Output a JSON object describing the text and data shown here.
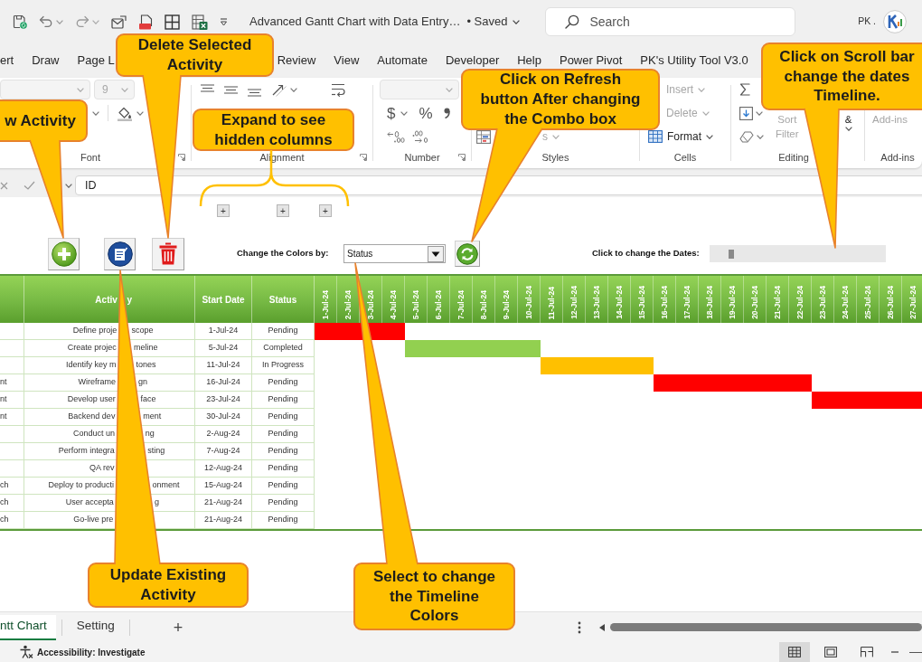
{
  "title_bar": {
    "title": "Advanced Gantt Chart with Data Entry…",
    "status": "• Saved",
    "search": {
      "placeholder": "Search"
    },
    "user": "PK ."
  },
  "tabs": [
    {
      "label": "ert"
    },
    {
      "label": "Draw"
    },
    {
      "label": "Page L"
    },
    {
      "label": "Review"
    },
    {
      "label": "View"
    },
    {
      "label": "Automate"
    },
    {
      "label": "Developer"
    },
    {
      "label": "Help"
    },
    {
      "label": "Power Pivot"
    },
    {
      "label": "PK's Utility Tool V3.0"
    }
  ],
  "ribbon": {
    "font": {
      "size": {
        "value": "9",
        "disabled": true
      },
      "label": "Font"
    },
    "alignment": {
      "label": "Alignment"
    },
    "number": {
      "currency": "$",
      "percent": "%",
      "label": "Number"
    },
    "styles": {
      "cell_styles": {
        "label": "s",
        "disabled": true
      },
      "label": "Styles"
    },
    "cells": {
      "buttons": [
        {
          "label": "Insert",
          "disabled": true
        },
        {
          "label": "Delete",
          "disabled": true
        },
        {
          "label": "Format",
          "disabled": false
        }
      ],
      "label": "Cells"
    },
    "editing": {
      "sort_filter": {
        "lines": [
          "Sort",
          "Filter"
        ],
        "disabled": true
      },
      "find_select": {
        "label": "&",
        "disabled": false
      },
      "label": "Editing"
    },
    "add_ins": {
      "button": {
        "label": "Add-ins",
        "disabled": true
      },
      "label": "Add-ins"
    }
  },
  "formula_bar": {
    "value": "ID"
  },
  "outline_buttons": [
    {
      "label": "+"
    },
    {
      "label": "+"
    },
    {
      "label": "+"
    }
  ],
  "controls": {
    "colors_label": "Change the Colors by:",
    "colors_dropdown": {
      "value": "Status"
    },
    "dates_label": "Click to change the Dates:"
  },
  "table": {
    "headers": {
      "activity": [
        "Activ",
        "y"
      ],
      "start_date": "Start Date",
      "status": "Status",
      "dates": [
        "1-Jul-24",
        "2-Jul-24",
        "3-Jul-24",
        "4-Jul-24",
        "5-Jul-24",
        "6-Jul-24",
        "7-Jul-24",
        "8-Jul-24",
        "9-Jul-24",
        "10-Jul-24",
        "11-Jul-24",
        "12-Jul-24",
        "13-Jul-24",
        "14-Jul-24",
        "15-Jul-24",
        "16-Jul-24",
        "17-Jul-24",
        "18-Jul-24",
        "19-Jul-24",
        "20-Jul-24",
        "21-Jul-24",
        "22-Jul-24",
        "23-Jul-24",
        "24-Jul-24",
        "25-Jul-24",
        "26-Jul-24",
        "27-Jul-24"
      ]
    },
    "rows": [
      {
        "activity": [
          "Define proje",
          "scope"
        ],
        "start_date": "1-Jul-24",
        "status": "Pending",
        "color": "#ff0000"
      },
      {
        "activity": [
          "Create projec",
          "meline"
        ],
        "start_date": "5-Jul-24",
        "status": "Completed",
        "color": "#92d050"
      },
      {
        "activity": [
          "Identify key m",
          "tones"
        ],
        "start_date": "11-Jul-24",
        "status": "In Progress",
        "color": "#ffc000"
      },
      {
        "phase": "nt",
        "activity": [
          "Wireframe",
          "gn"
        ],
        "start_date": "16-Jul-24",
        "status": "Pending",
        "color": "#ff0000"
      },
      {
        "phase": "nt",
        "activity": [
          "Develop user",
          "face"
        ],
        "start_date": "23-Jul-24",
        "status": "Pending",
        "color": "#ff0000"
      },
      {
        "phase": "nt",
        "activity": [
          "Backend dev",
          "ment"
        ],
        "start_date": "30-Jul-24",
        "status": "Pending"
      },
      {
        "activity": [
          "Conduct un",
          "ng"
        ],
        "start_date": "2-Aug-24",
        "status": "Pending"
      },
      {
        "activity": [
          "Perform integra",
          "sting"
        ],
        "start_date": "7-Aug-24",
        "status": "Pending"
      },
      {
        "activity": [
          "QA rev"
        ],
        "start_date": "12-Aug-24",
        "status": "Pending"
      },
      {
        "phase": "ch",
        "activity": [
          "Deploy to producti",
          "onment"
        ],
        "start_date": "15-Aug-24",
        "status": "Pending"
      },
      {
        "phase": "ch",
        "activity": [
          "User accepta",
          "g"
        ],
        "start_date": "21-Aug-24",
        "status": "Pending"
      },
      {
        "phase": "ch",
        "activity": [
          "Go-live pre"
        ],
        "start_date": "21-Aug-24",
        "status": "Pending"
      }
    ]
  },
  "callouts": [
    {
      "text": "w Activity"
    },
    {
      "text": "Delete Selected\nActivity"
    },
    {
      "text": "Expand to see\nhidden columns"
    },
    {
      "text": "Click on Refresh\nbutton After changing\nthe Combo box"
    },
    {
      "text": "Click on Scroll bar\nchange the dates\nTimeline."
    },
    {
      "text": "Update Existing\nActivity"
    },
    {
      "text": "Select to change\nthe Timeline\nColors"
    }
  ],
  "sheet_tabs": [
    {
      "label": "ntt Chart",
      "selected": true
    },
    {
      "label": "Setting",
      "selected": false
    }
  ],
  "add_sheet": "+",
  "status_bar": {
    "accessibility": "Accessibility: Investigate",
    "views": [
      {
        "kind": "normal",
        "selected": true
      },
      {
        "kind": "page_layout",
        "selected": false
      },
      {
        "kind": "page_break",
        "selected": false
      }
    ]
  }
}
